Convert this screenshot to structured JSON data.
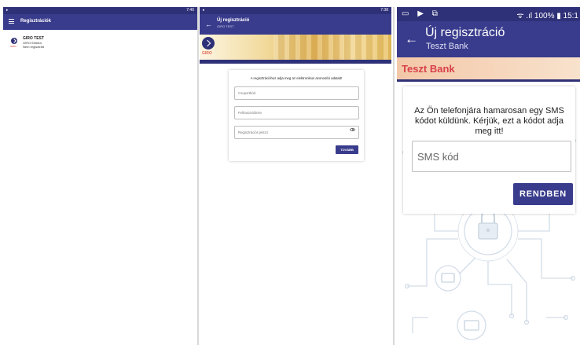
{
  "screen1": {
    "status": {
      "left_icon": "▸",
      "time": "7:46"
    },
    "appbar": {
      "title": "Regisztrációk",
      "menu_icon": "menu-icon"
    },
    "list": [
      {
        "title": "GIRO TEST",
        "line1": "GIRO Elektra",
        "line2": "Nem regisztrált",
        "logo_text": "GIRO"
      }
    ]
  },
  "screen2": {
    "status": {
      "left_icon": "▸",
      "time": "7:38"
    },
    "appbar": {
      "title": "Új regisztráció",
      "subtitle": "GIRO TEST",
      "back_icon": "←"
    },
    "banner": {
      "logo_text": "GIRO"
    },
    "card": {
      "instruction": "A regisztrációhoz adja meg az elektronikus azonosító adatait!",
      "fields": [
        {
          "placeholder": "Csoportkód"
        },
        {
          "placeholder": "Felhasználónév"
        },
        {
          "placeholder": "Regisztrációs jelszó"
        }
      ],
      "next_label": "TOVÁBB"
    }
  },
  "screen3": {
    "status": {
      "icons": "▭ ▶ ⧉",
      "right": "ᯤ .ıl 100% ▮ 15:1"
    },
    "appbar": {
      "title": "Új regisztráció",
      "subtitle": "Teszt Bank",
      "back_icon": "←"
    },
    "bank_name": "Teszt Bank",
    "card": {
      "instruction": "Az Ön telefonjára hamarosan egy SMS kódot küldünk. Kérjük, ezt a kódot adja meg itt!",
      "sms_placeholder": "SMS kód",
      "ok_label": "RENDBEN"
    }
  },
  "colors": {
    "primary": "#393c8c",
    "status_bar": "#2f3178",
    "bank_accent": "#d8404a",
    "giro_accent": "#e06a5a"
  }
}
